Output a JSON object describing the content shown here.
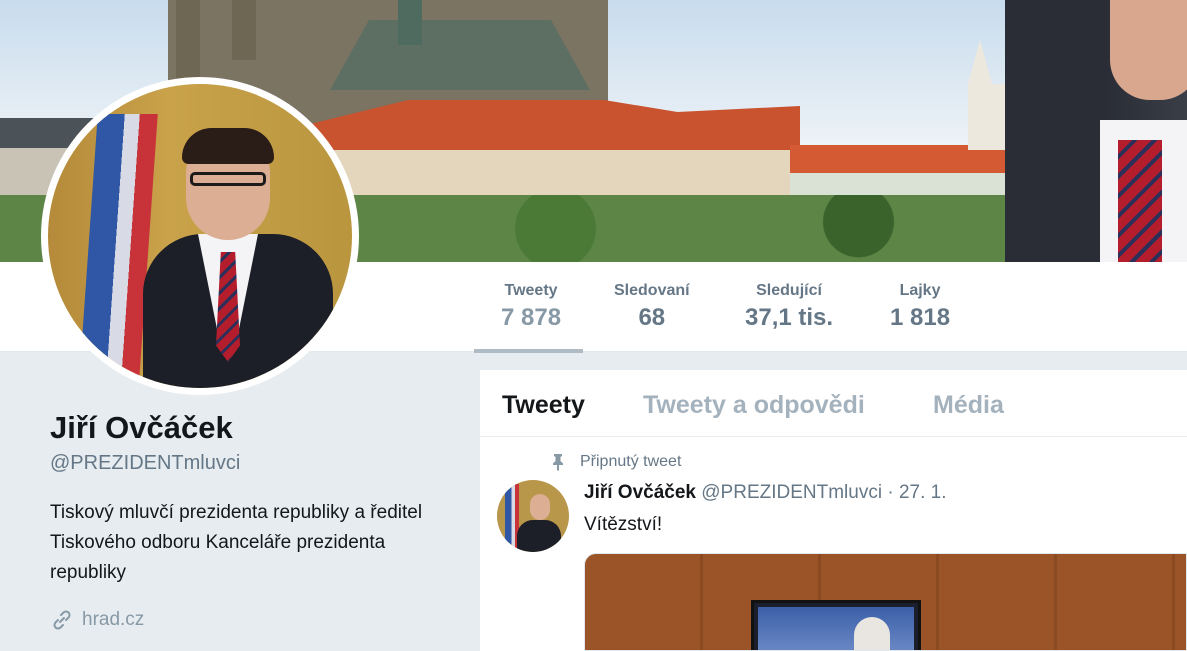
{
  "profile": {
    "name": "Jiří Ovčáček",
    "handle": "@PREZIDENTmluvci",
    "bio": "Tiskový mluvčí prezidenta republiky a ředitel Tiskového odboru Kanceláře prezidenta republiky",
    "link": "hrad.cz"
  },
  "stats": [
    {
      "label": "Tweety",
      "value": "7 878"
    },
    {
      "label": "Sledovaní",
      "value": "68"
    },
    {
      "label": "Sledující",
      "value": "37,1 tis."
    },
    {
      "label": "Lajky",
      "value": "1 818"
    }
  ],
  "timeline": {
    "tabs": [
      "Tweety",
      "Tweety a odpovědi",
      "Média"
    ],
    "pinned_label": "Připnutý tweet",
    "tweet": {
      "author": "Jiří Ovčáček",
      "handle": "@PREZIDENTmluvci",
      "date": "27. 1.",
      "text": "Vítězství!"
    }
  },
  "colors": {
    "accent": "#1da1f2",
    "text": "#14171a",
    "secondary": "#657786",
    "background": "#e6ecf0"
  },
  "icons": {
    "pin": "pin-icon",
    "link": "link-icon"
  }
}
